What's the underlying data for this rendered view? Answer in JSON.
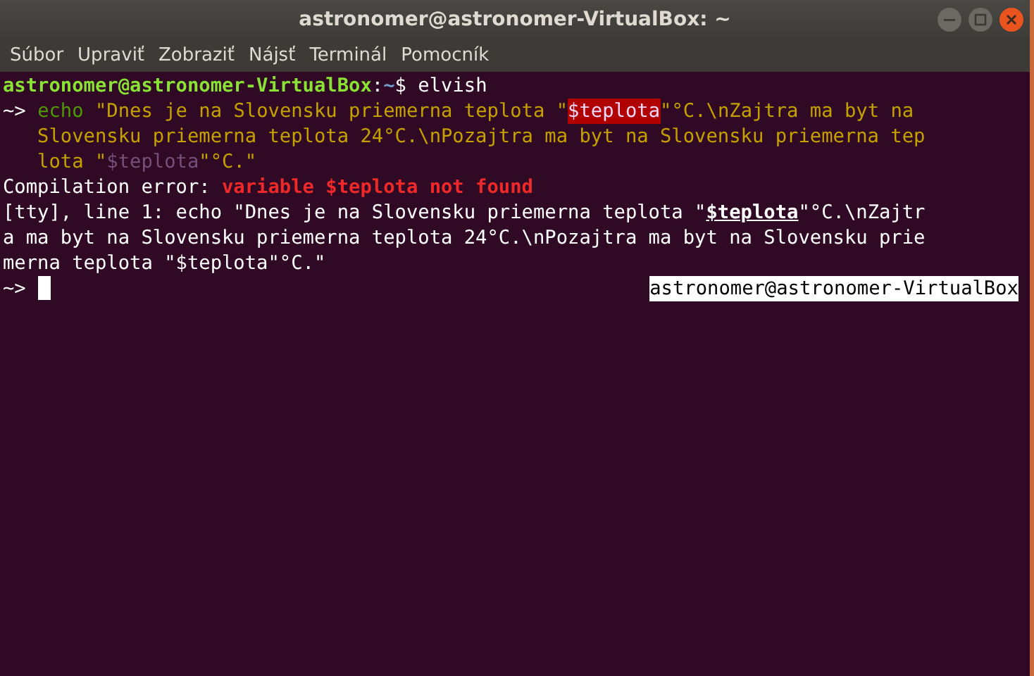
{
  "window": {
    "title": "astronomer@astronomer-VirtualBox: ~"
  },
  "menu": [
    "Súbor",
    "Upraviť",
    "Zobraziť",
    "Nájsť",
    "Terminál",
    "Pomocník"
  ],
  "terminal": {
    "lines": [
      [
        {
          "kind": "user",
          "text": "astronomer@astronomer-VirtualBox"
        },
        {
          "kind": "plain",
          "text": ":"
        },
        {
          "kind": "path",
          "text": "~"
        },
        {
          "kind": "plain",
          "text": "$ elvish"
        }
      ],
      [
        {
          "kind": "plain",
          "text": "~> "
        },
        {
          "kind": "command",
          "text": "echo"
        },
        {
          "kind": "string",
          "text": " \"Dnes je na Slovensku priemerna teplota \""
        },
        {
          "kind": "var_error",
          "text": "$teplota"
        },
        {
          "kind": "string",
          "text": "\"°C.\\nZajtra ma byt na"
        }
      ],
      [
        {
          "kind": "string",
          "text": "   Slovensku priemerna teplota 24°C.\\nPozajtra ma byt na Slovensku priemerna tep"
        }
      ],
      [
        {
          "kind": "string",
          "text": "   lota \""
        },
        {
          "kind": "var",
          "text": "$teplota"
        },
        {
          "kind": "string",
          "text": "\"°C.\""
        }
      ],
      [
        {
          "kind": "plain",
          "text": "Compilation error: "
        },
        {
          "kind": "error",
          "text": "variable $teplota not found"
        }
      ],
      [
        {
          "kind": "plain",
          "text": "[tty], line 1: echo \"Dnes je na Slovensku priemerna teplota \""
        },
        {
          "kind": "highlight",
          "text": "$teplota"
        },
        {
          "kind": "plain",
          "text": "\"°C.\\nZajtr"
        }
      ],
      [
        {
          "kind": "plain",
          "text": "a ma byt na Slovensku priemerna teplota 24°C.\\nPozajtra ma byt na Slovensku prie"
        }
      ],
      [
        {
          "kind": "plain",
          "text": "merna teplota \"$teplota\"°C.\""
        }
      ]
    ],
    "prompt": "~> ",
    "right_prompt": "astronomer@astronomer-VirtualBox"
  }
}
